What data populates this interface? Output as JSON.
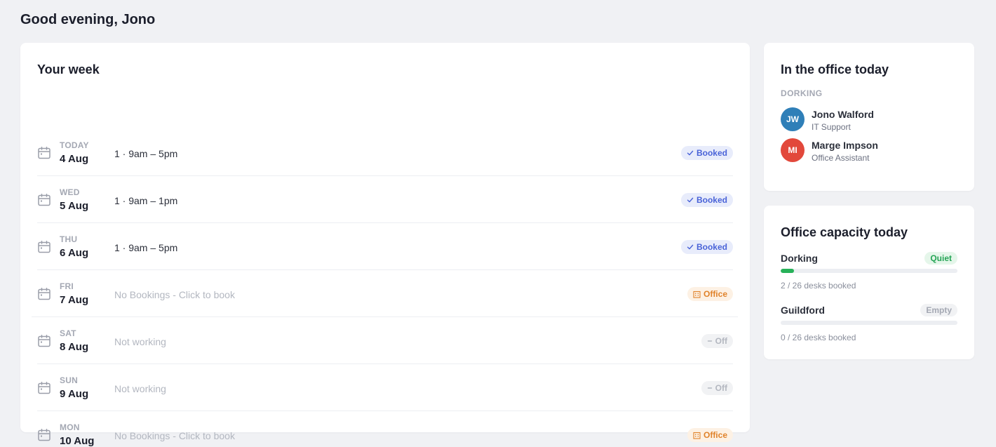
{
  "greeting": "Good evening, Jono",
  "week": {
    "title": "Your week",
    "days": [
      {
        "day": "TODAY",
        "date": "4 Aug",
        "detail": "1 · 9am – 5pm",
        "status": "booked",
        "badge": "Booked",
        "badge_icon": "check-icon"
      },
      {
        "day": "WED",
        "date": "5 Aug",
        "detail": "1 · 9am – 1pm",
        "status": "booked",
        "badge": "Booked",
        "badge_icon": "check-icon"
      },
      {
        "day": "THU",
        "date": "6 Aug",
        "detail": "1 · 9am – 5pm",
        "status": "booked",
        "badge": "Booked",
        "badge_icon": "check-icon"
      },
      {
        "day": "FRI",
        "date": "7 Aug",
        "detail": "No Bookings - Click to book",
        "status": "office",
        "badge": "Office",
        "badge_icon": "building-icon"
      },
      {
        "day": "SAT",
        "date": "8 Aug",
        "detail": "Not working",
        "status": "off",
        "badge": "Off",
        "badge_icon": "minus-icon"
      },
      {
        "day": "SUN",
        "date": "9 Aug",
        "detail": "Not working",
        "status": "off",
        "badge": "Off",
        "badge_icon": "minus-icon"
      },
      {
        "day": "MON",
        "date": "10 Aug",
        "detail": "No Bookings - Click to book",
        "status": "office",
        "badge": "Office",
        "badge_icon": "building-icon"
      }
    ]
  },
  "in_office": {
    "title": "In the office today",
    "location": "DORKING",
    "people": [
      {
        "initials": "JW",
        "name": "Jono Walford",
        "role": "IT Support",
        "color": "#2f7fb8"
      },
      {
        "initials": "MI",
        "name": "Marge Impson",
        "role": "Office Assistant",
        "color": "#e2483b"
      }
    ]
  },
  "capacity": {
    "title": "Office capacity today",
    "offices": [
      {
        "name": "Dorking",
        "status": "Quiet",
        "status_kind": "quiet",
        "booked": 2,
        "total": 26,
        "text": "2 / 26 desks booked"
      },
      {
        "name": "Guildford",
        "status": "Empty",
        "status_kind": "empty",
        "booked": 0,
        "total": 26,
        "text": "0 / 26 desks booked"
      }
    ]
  },
  "colors": {
    "background": "#f0f1f4",
    "booked": "#4a63d8",
    "office": "#e0822a",
    "quiet": "#25a455"
  }
}
